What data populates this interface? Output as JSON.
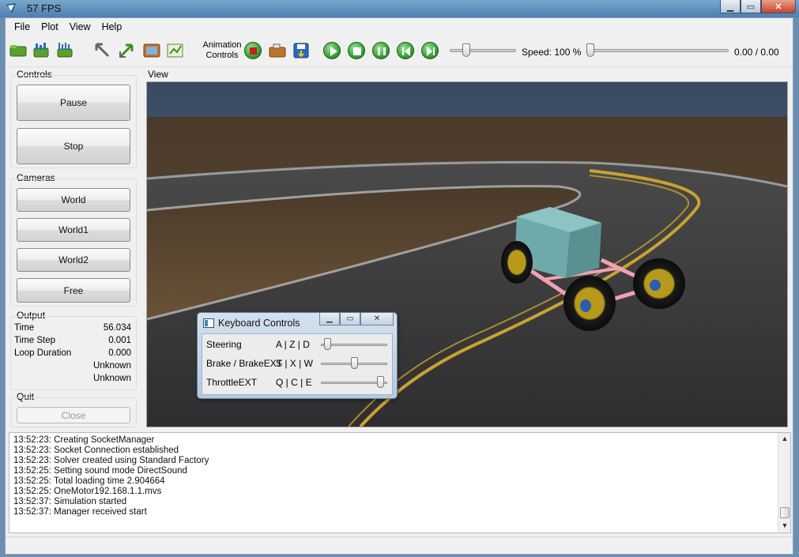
{
  "window": {
    "title": "57  FPS"
  },
  "menu": [
    {
      "label": "File"
    },
    {
      "label": "Plot"
    },
    {
      "label": "View"
    },
    {
      "label": "Help"
    }
  ],
  "toolbar": {
    "animation_label_line1": "Animation",
    "animation_label_line2": "Controls",
    "speed_label": "Speed: 100 %",
    "time_readout": "0.00 / 0.00",
    "progress_fraction": 0.22,
    "speed_fraction": 0.0
  },
  "controls": {
    "title": "Controls",
    "pause_label": "Pause",
    "stop_label": "Stop"
  },
  "cameras": {
    "title": "Cameras",
    "items": [
      "World",
      "World1",
      "World2",
      "Free"
    ]
  },
  "output": {
    "title": "Output",
    "rows": [
      {
        "label": "Time",
        "value": "56.034"
      },
      {
        "label": "Time Step",
        "value": "0.001"
      },
      {
        "label": "Loop Duration",
        "value": "0.000"
      },
      {
        "label": "",
        "value": "Unknown"
      },
      {
        "label": "",
        "value": "Unknown"
      }
    ]
  },
  "quit": {
    "title": "Quit",
    "close_label": "Close"
  },
  "view": {
    "title": "View"
  },
  "keyboard": {
    "title": "Keyboard Controls",
    "rows": [
      {
        "label": "Steering",
        "keys": "A | Z | D",
        "level": 0.05
      },
      {
        "label": "Brake / BrakeEXT",
        "keys": "S | X | W",
        "level": 0.5
      },
      {
        "label": "ThrottleEXT",
        "keys": "Q | C | E",
        "level": 0.95
      }
    ]
  },
  "log": [
    "13:52:23: Creating SocketManager",
    "13:52:23: Socket Connection established",
    "13:52:23: Solver created using Standard Factory",
    "13:52:25: Setting sound mode DirectSound",
    "13:52:25: Total loading time 2.904664",
    "13:52:25: OneMotor192.168.1.1.mvs",
    "13:52:37: Simulation started",
    "13:52:37: Manager received start"
  ],
  "colors": {
    "accent_green": "#2f9a2f",
    "record_red": "#d11a1a",
    "chassis_pink": "#f2a0b4",
    "body_teal": "#6fa9a9"
  },
  "icons": {
    "app": "app-logo-icon",
    "window_buttons": [
      "minimize-icon",
      "maximize-icon",
      "close-icon"
    ]
  }
}
